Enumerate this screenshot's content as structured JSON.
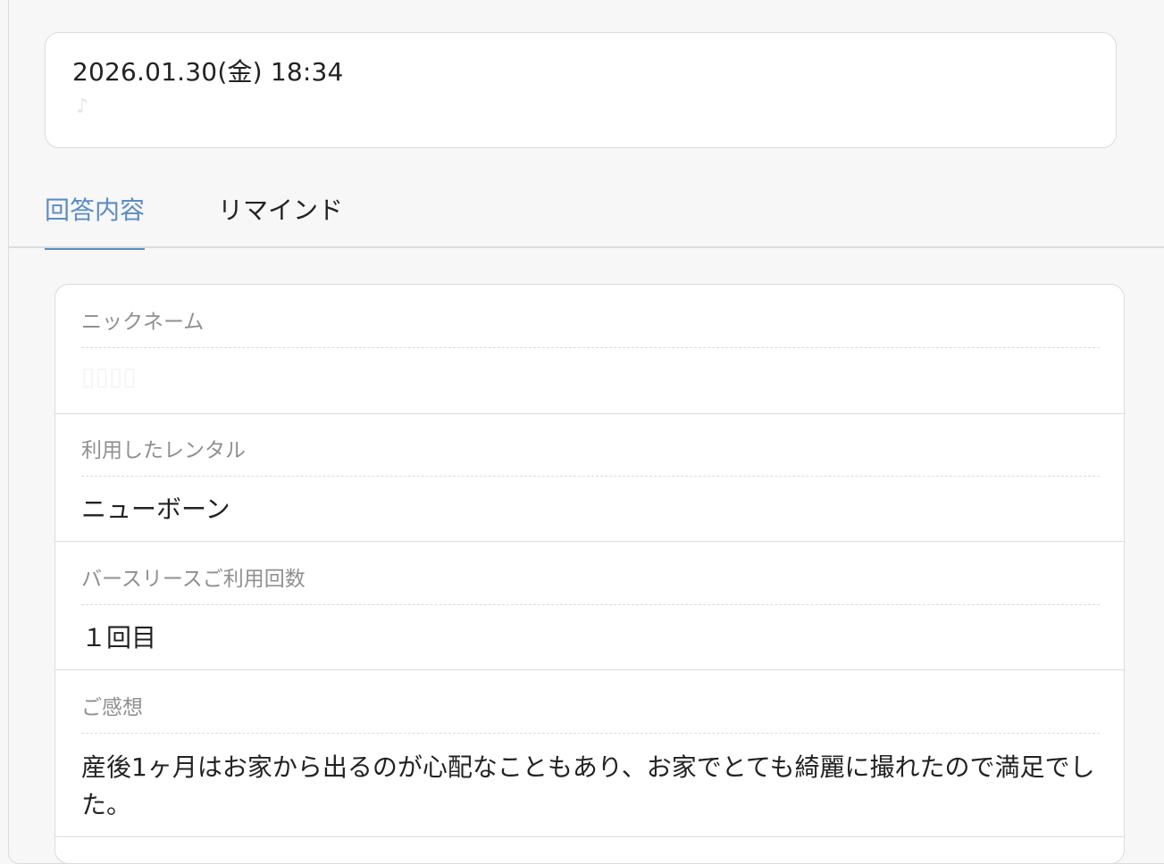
{
  "header": {
    "datetime": "2026.01.30(金) 18:34",
    "sub_text": "♪"
  },
  "tabs": [
    {
      "label": "回答内容",
      "active": true
    },
    {
      "label": "リマインド",
      "active": false
    }
  ],
  "answers": [
    {
      "label": "ニックネーム",
      "value": "▯▯▯▯"
    },
    {
      "label": "利用したレンタル",
      "value": "ニューボーン"
    },
    {
      "label": "バースリースご利用回数",
      "value": "１回目"
    },
    {
      "label": "ご感想",
      "value": "産後1ヶ月はお家から出るのが心配なこともあり、お家でとても綺麗に撮れたので満足でした。"
    }
  ],
  "colors": {
    "accent": "#5c8cc4",
    "background": "#f7f7f7",
    "card": "#ffffff",
    "border": "#dcdcdc",
    "label_text": "#8f8f8f"
  }
}
